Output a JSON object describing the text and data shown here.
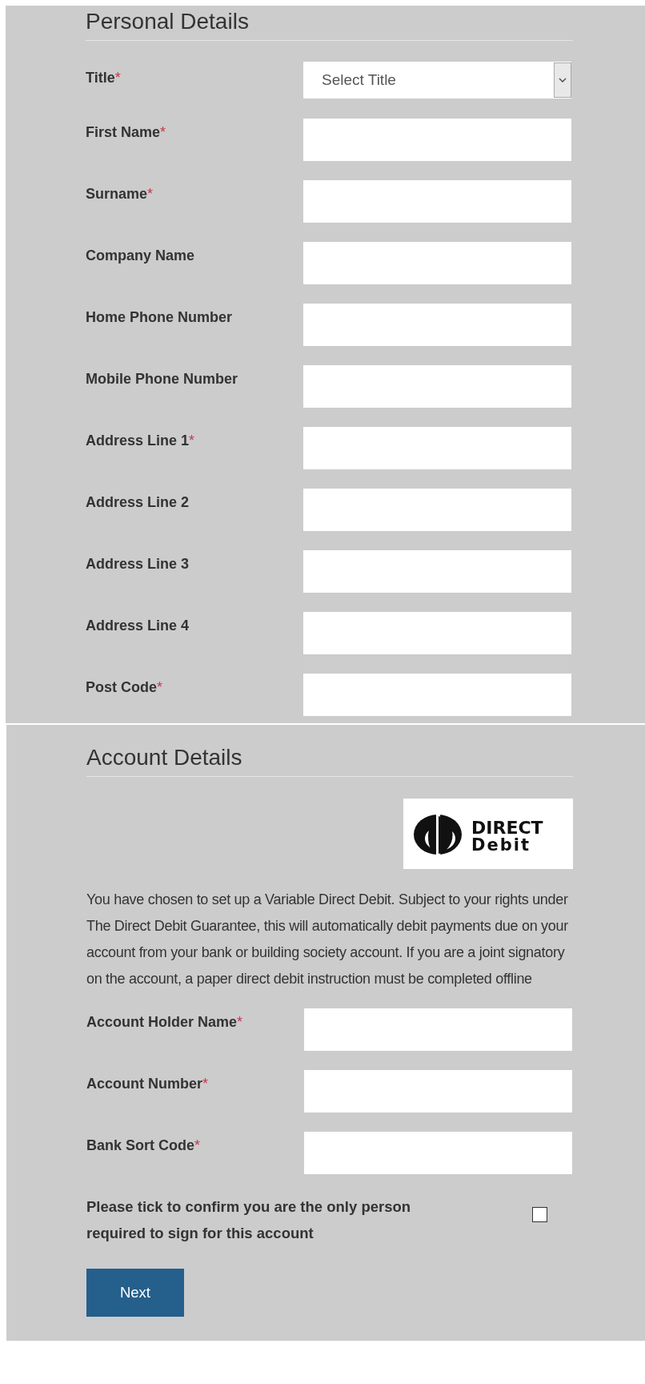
{
  "personal_details": {
    "heading": "Personal Details",
    "fields": [
      {
        "kind": "select",
        "label": "Title",
        "required_mark": "*",
        "placeholder": "Select Title"
      },
      {
        "kind": "text",
        "label": "First Name",
        "required_mark": "*"
      },
      {
        "kind": "text",
        "label": "Surname",
        "required_mark": "*"
      },
      {
        "kind": "text",
        "label": "Company Name"
      },
      {
        "kind": "text",
        "label": "Home Phone Number"
      },
      {
        "kind": "text",
        "label": "Mobile Phone Number"
      },
      {
        "kind": "text",
        "label": "Address Line 1",
        "required_mark": "*"
      },
      {
        "kind": "text",
        "label": "Address Line 2"
      },
      {
        "kind": "text",
        "label": "Address Line 3"
      },
      {
        "kind": "text",
        "label": "Address Line 4"
      },
      {
        "kind": "text",
        "label": "Post Code",
        "required_mark": "*"
      }
    ]
  },
  "account_details": {
    "heading": "Account Details",
    "logo": {
      "line_1": "DIRECT",
      "line_2": "Debit"
    },
    "notice": "You have chosen to set up a Variable Direct Debit. Subject to your rights under The Direct Debit Guarantee, this will automatically debit payments due on your account from your bank or building society account. If you are a joint signatory on the account, a paper direct debit instruction must be completed offline",
    "fields": [
      {
        "kind": "text",
        "label": "Account Holder Name",
        "required_mark": "*"
      },
      {
        "kind": "text",
        "label": "Account Number",
        "required_mark": "*"
      },
      {
        "kind": "text",
        "label": "Bank Sort Code",
        "required_mark": "*"
      }
    ],
    "confirm": {
      "label": "Please tick to confirm you are the only person required to sign for this account",
      "checked": false
    },
    "button": "Next"
  }
}
